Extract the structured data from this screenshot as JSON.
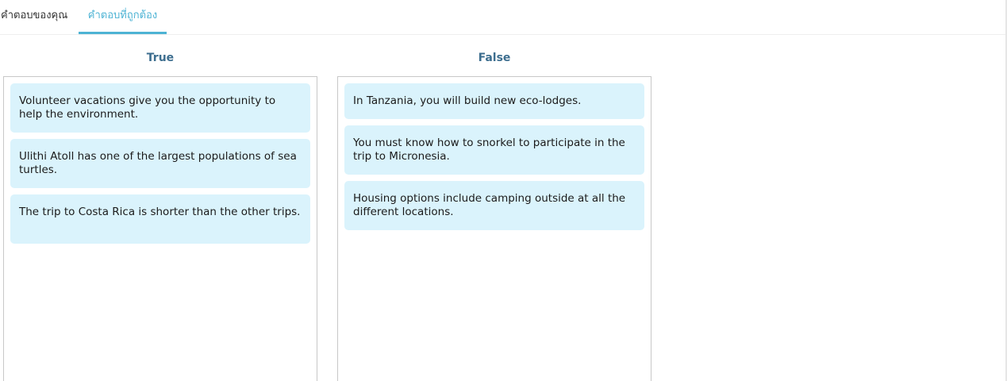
{
  "tabs": [
    {
      "label": "คำตอบของคุณ",
      "active": false
    },
    {
      "label": "คำตอบที่ถูกต้อง",
      "active": true
    }
  ],
  "columns": [
    {
      "title": "True",
      "items": [
        "Volunteer vacations give you the opportunity to help the environment.",
        "Ulithi Atoll has one of the largest populations of sea turtles.",
        "The trip to Costa Rica is shorter than the other trips."
      ]
    },
    {
      "title": "False",
      "items": [
        "In Tanzania, you will build new eco-lodges.",
        "You must know how to snorkel to participate in the trip to Micronesia.",
        "Housing options include camping outside at all the different locations."
      ]
    }
  ],
  "colors": {
    "accent": "#4db3d4",
    "column_title": "#3d6e8f",
    "card_background": "#daf3fc",
    "border": "#c8c8c8"
  }
}
